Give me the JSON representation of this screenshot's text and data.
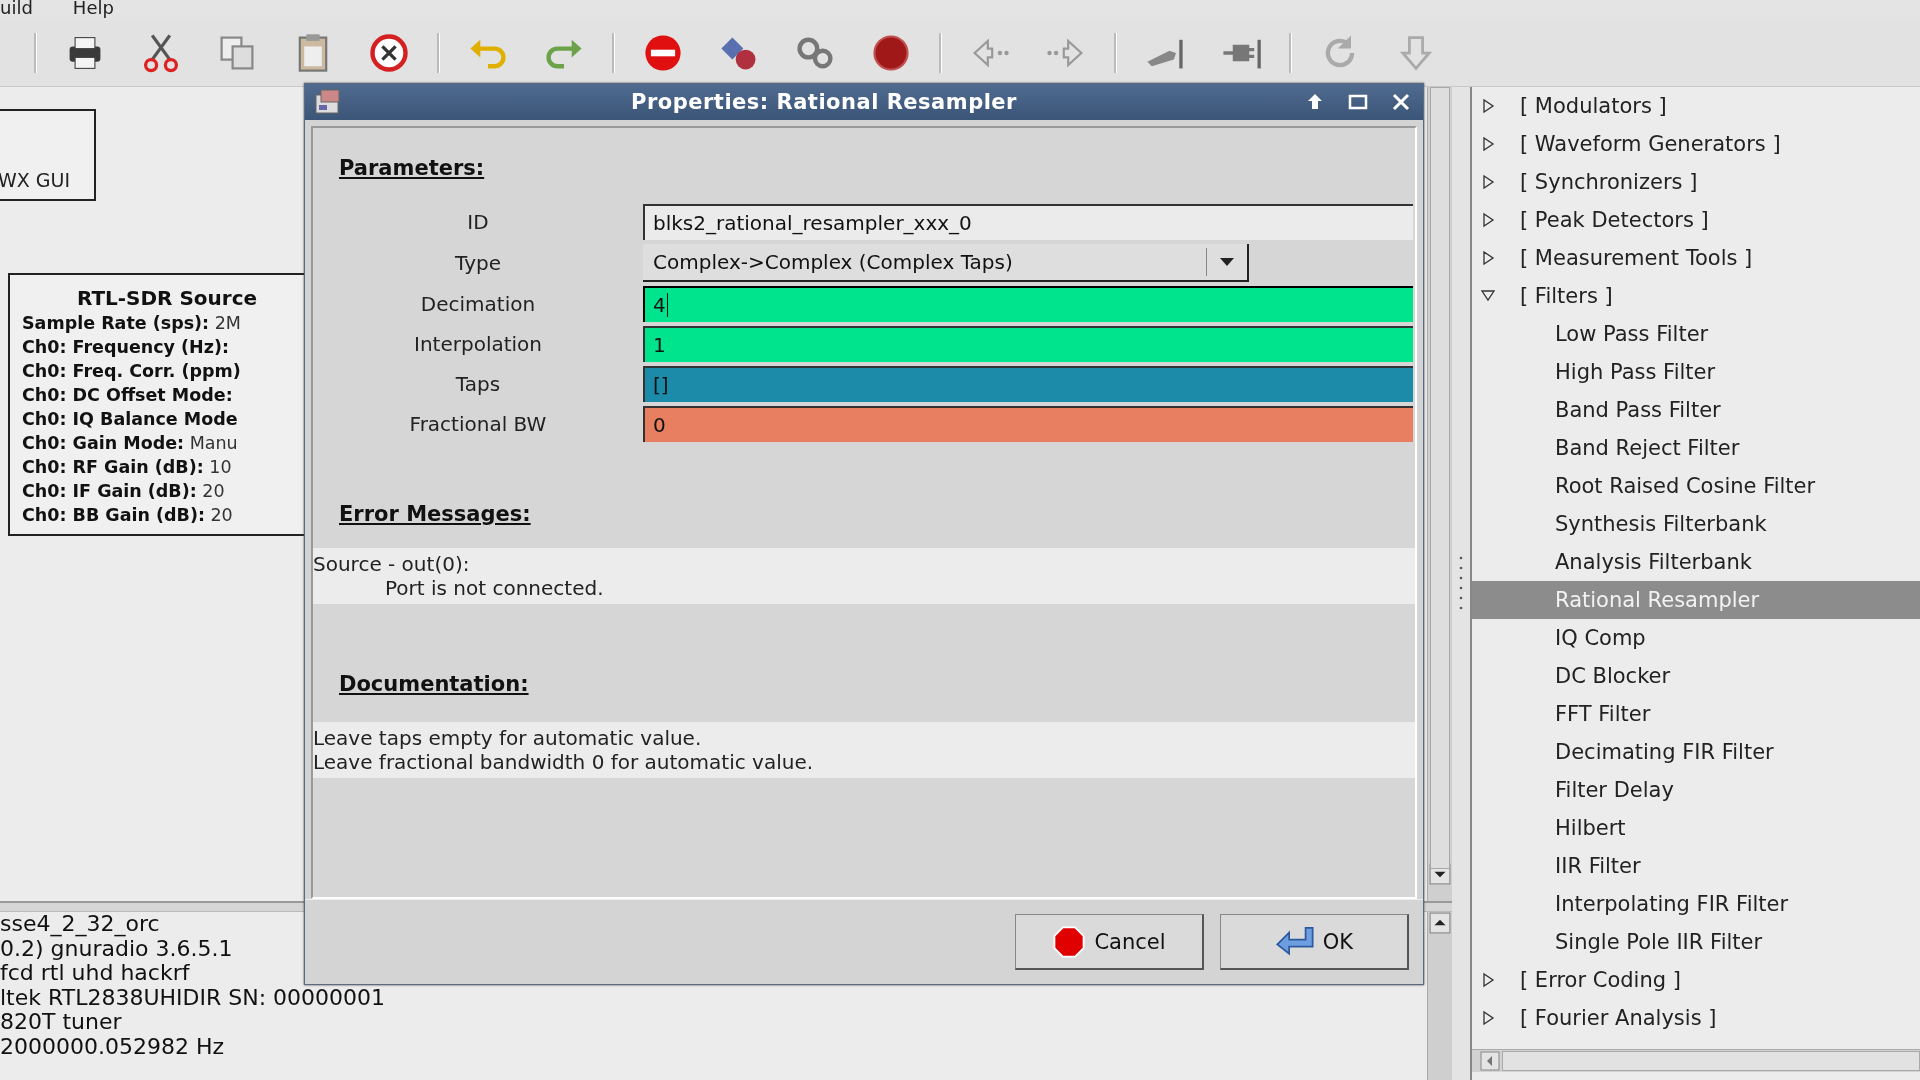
{
  "menu": [
    "uild",
    "Help"
  ],
  "canvas": {
    "blocks": [
      {
        "kind": "label",
        "title": "WX GUI"
      },
      {
        "kind": "params",
        "title": "RTL-SDR Source",
        "params": [
          {
            "label": "Sample Rate (sps):",
            "value": "2M"
          },
          {
            "label": "Ch0: Frequency (Hz):"
          },
          {
            "label": "Ch0: Freq. Corr. (ppm)"
          },
          {
            "label": "Ch0: DC Offset Mode:"
          },
          {
            "label": "Ch0: IQ Balance Mode"
          },
          {
            "label": "Ch0: Gain Mode:",
            "value": "Manu"
          },
          {
            "label": "Ch0: RF Gain (dB):",
            "value": "10"
          },
          {
            "label": "Ch0: IF Gain (dB):",
            "value": "20"
          },
          {
            "label": "Ch0: BB Gain (dB):",
            "value": "20"
          }
        ]
      }
    ]
  },
  "console": {
    "lines": [
      "sse4_2_32_orc",
      "0.2) gnuradio 3.6.5.1",
      "fcd rtl uhd hackrf",
      "ltek RTL2838UHIDIR SN: 00000001",
      "820T tuner",
      "2000000.052982 Hz"
    ]
  },
  "dialog": {
    "title": "Properties: Rational Resampler",
    "parameters_heading": "Parameters:",
    "params": [
      {
        "label": "ID",
        "kind": "entry",
        "value": "blks2_rational_resampler_xxx_0",
        "color": "#ebebeb",
        "focused": false
      },
      {
        "label": "Type",
        "kind": "dropdown",
        "value": "Complex->Complex (Complex Taps)",
        "focused": false
      },
      {
        "label": "Decimation",
        "kind": "entry",
        "value": "4",
        "color": "#00e48e",
        "focused": true
      },
      {
        "label": "Interpolation",
        "kind": "entry",
        "value": "1",
        "color": "#00e48e",
        "focused": false
      },
      {
        "label": "Taps",
        "kind": "entry",
        "value": "[]",
        "color": "#1b8ba9",
        "focused": false
      },
      {
        "label": "Fractional BW",
        "kind": "entry",
        "value": "0",
        "color": "#e87f60",
        "focused": false
      }
    ],
    "errors_heading": "Error Messages:",
    "errors": {
      "source": "Source - out(0):",
      "messages": [
        "Port is not connected."
      ]
    },
    "documentation_heading": "Documentation:",
    "documentation": [
      "Leave taps empty for automatic value.",
      "Leave fractional bandwidth 0 for automatic value."
    ],
    "buttons": [
      {
        "kind": "cancel",
        "label": "Cancel"
      },
      {
        "kind": "ok",
        "label": "OK"
      }
    ]
  },
  "block_tree": [
    {
      "label": "[ Modulators ]",
      "expanded": false
    },
    {
      "label": "[ Waveform Generators ]",
      "expanded": false
    },
    {
      "label": "[ Synchronizers ]",
      "expanded": false
    },
    {
      "label": "[ Peak Detectors ]",
      "expanded": false
    },
    {
      "label": "[ Measurement Tools ]",
      "expanded": false
    },
    {
      "label": "[ Filters ]",
      "expanded": true,
      "children": [
        {
          "label": "Low Pass Filter",
          "selected": false
        },
        {
          "label": "High Pass Filter",
          "selected": false
        },
        {
          "label": "Band Pass Filter",
          "selected": false
        },
        {
          "label": "Band Reject Filter",
          "selected": false
        },
        {
          "label": "Root Raised Cosine Filter",
          "selected": false
        },
        {
          "label": "Synthesis Filterbank",
          "selected": false
        },
        {
          "label": "Analysis Filterbank",
          "selected": false
        },
        {
          "label": "Rational Resampler",
          "selected": true
        },
        {
          "label": "IQ Comp",
          "selected": false
        },
        {
          "label": "DC Blocker",
          "selected": false
        },
        {
          "label": "FFT Filter",
          "selected": false
        },
        {
          "label": "Decimating FIR Filter",
          "selected": false
        },
        {
          "label": "Filter Delay",
          "selected": false
        },
        {
          "label": "Hilbert",
          "selected": false
        },
        {
          "label": "IIR Filter",
          "selected": false
        },
        {
          "label": "Interpolating FIR Filter",
          "selected": false
        },
        {
          "label": "Single Pole IIR Filter",
          "selected": false
        }
      ]
    },
    {
      "label": "[ Error Coding ]",
      "expanded": false
    },
    {
      "label": "[ Fourier Analysis ]",
      "expanded": false
    }
  ]
}
